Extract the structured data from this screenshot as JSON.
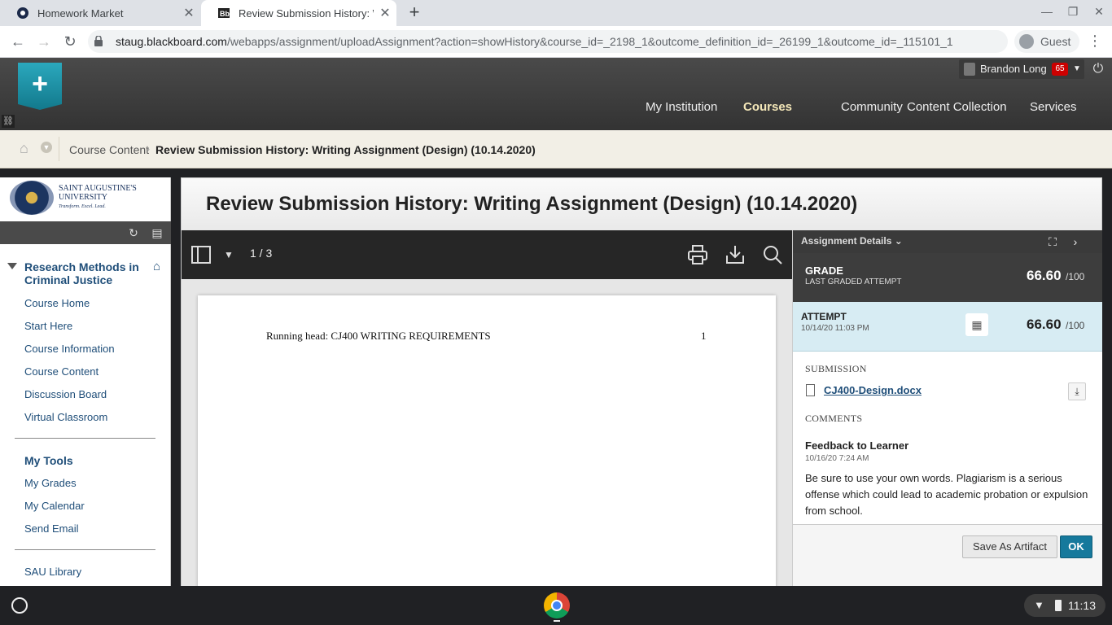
{
  "browser": {
    "tabs": [
      {
        "title": "Homework Market",
        "active": false
      },
      {
        "title": "Review Submission History: Writ",
        "active": true
      }
    ],
    "url_host": "staug.blackboard.com",
    "url_path": "/webapps/assignment/uploadAssignment?action=showHistory&course_id=_2198_1&outcome_definition_id=_26199_1&outcome_id=_115101_1",
    "profile_label": "Guest"
  },
  "bb": {
    "user_name": "Brandon Long",
    "notification_count": "65",
    "nav": [
      "My Institution",
      "Courses",
      "Community",
      "Content Collection",
      "Services"
    ],
    "active_nav": "Courses"
  },
  "breadcrumb": {
    "course": "Course Content",
    "page": "Review Submission History: Writing Assignment (Design) (10.14.2020)"
  },
  "left_menu": {
    "university_name": "SAINT AUGUSTINE'S UNIVERSITY",
    "university_tagline": "Transform. Excel. Lead.",
    "course_title": "Research Methods in Criminal Justice",
    "items": [
      "Course Home",
      "Start Here",
      "Course Information",
      "Course Content",
      "Discussion Board",
      "Virtual Classroom"
    ],
    "tools_heading": "My Tools",
    "tools": [
      "My Grades",
      "My Calendar",
      "Send Email"
    ],
    "library": "SAU Library"
  },
  "main": {
    "title": "Review Submission History: Writing Assignment (Design) (10.14.2020)"
  },
  "viewer": {
    "page_indicator": "1 / 3",
    "running_head": "Running head: CJ400 WRITING REQUIREMENTS",
    "doc_page_number": "1"
  },
  "panel": {
    "header": "Assignment Details",
    "grade_label": "GRADE",
    "grade_sublabel": "LAST GRADED ATTEMPT",
    "grade_score": "66.60",
    "grade_outof": "/100",
    "attempt_label": "ATTEMPT",
    "attempt_date": "10/14/20 11:03 PM",
    "attempt_score": "66.60",
    "attempt_outof": "/100",
    "submission_label": "SUBMISSION",
    "file_name": "CJ400-Design.docx",
    "comments_label": "COMMENTS",
    "feedback_title": "Feedback to Learner",
    "feedback_date": "10/16/20 7:24 AM",
    "feedback_text": "Be sure to use your own words. Plagiarism is a serious offense which could lead to academic probation or expulsion from school.",
    "save_artifact": "Save As Artifact",
    "ok": "OK"
  },
  "shelf": {
    "time": "11:13"
  }
}
